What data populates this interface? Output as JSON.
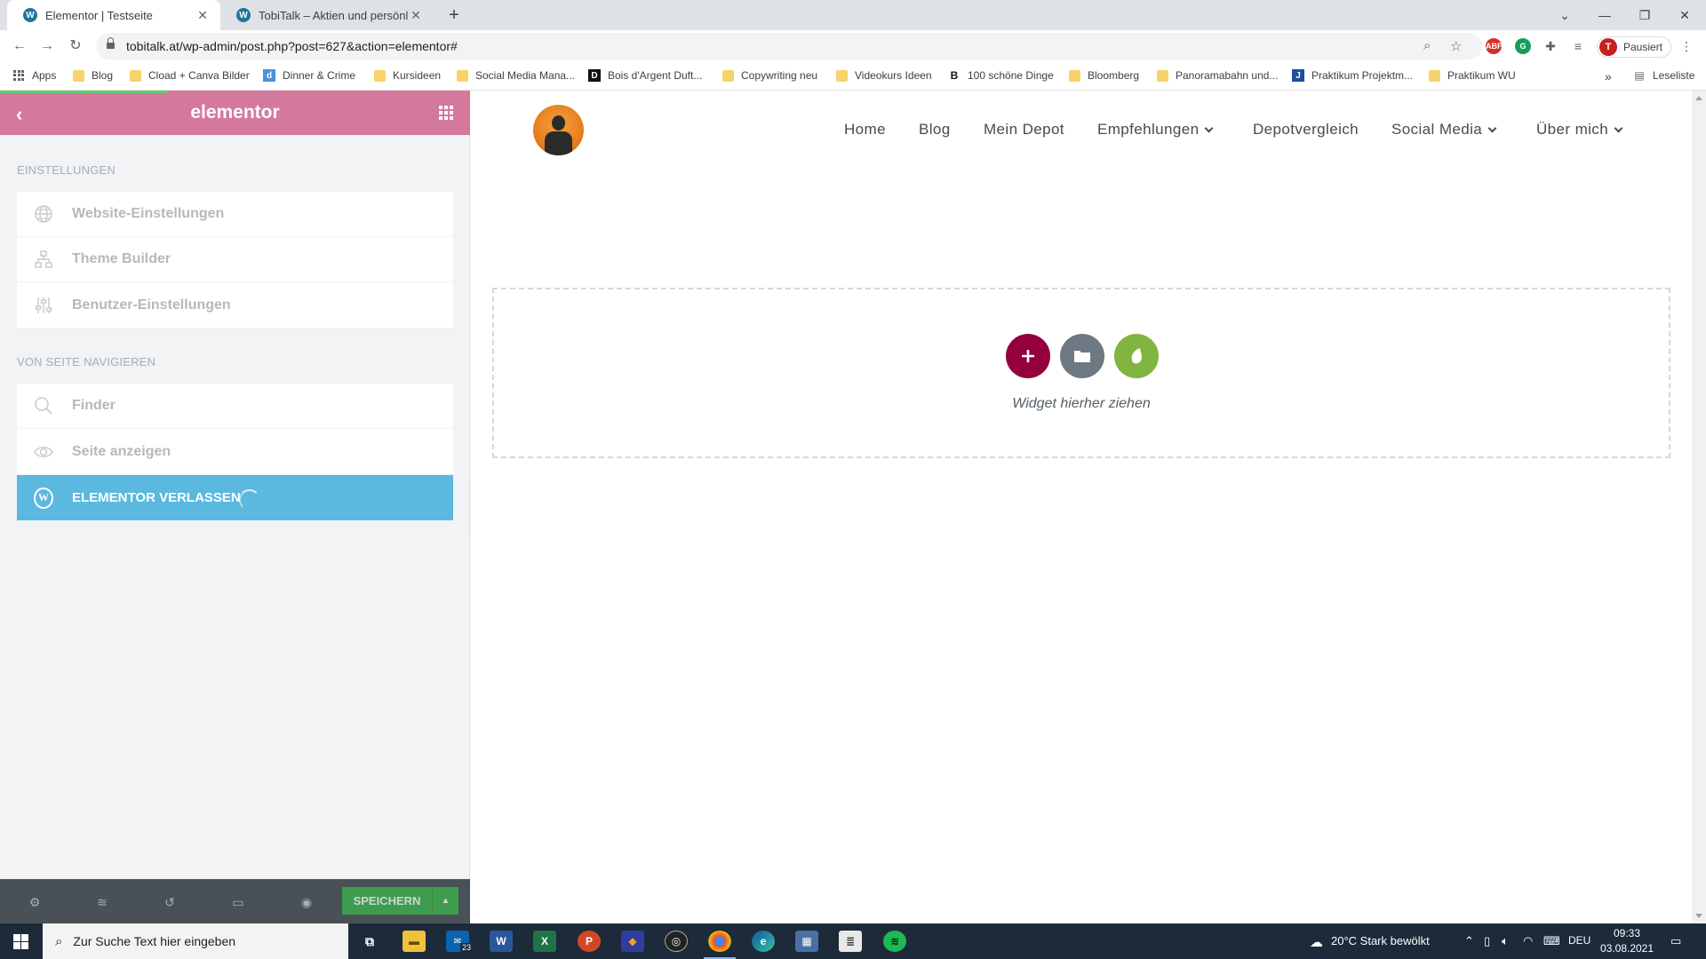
{
  "browser": {
    "tabs": [
      {
        "title": "Elementor | Testseite",
        "active": true
      },
      {
        "title": "TobiTalk – Aktien und persönliche",
        "active": false
      }
    ],
    "url": "tobitalk.at/wp-admin/post.php?post=627&action=elementor#",
    "profile_label": "Pausiert",
    "profile_initial": "T",
    "bookmarks": [
      {
        "label": "Apps",
        "icon": "apps-grid-icon"
      },
      {
        "label": "Blog",
        "icon": "folder-icon"
      },
      {
        "label": "Cload + Canva Bilder",
        "icon": "folder-icon"
      },
      {
        "label": "Dinner & Crime",
        "icon": "site-icon"
      },
      {
        "label": "Kursideen",
        "icon": "folder-icon"
      },
      {
        "label": "Social Media Mana...",
        "icon": "folder-icon"
      },
      {
        "label": "Bois d'Argent Duft...",
        "icon": "site-icon"
      },
      {
        "label": "Copywriting neu",
        "icon": "folder-icon"
      },
      {
        "label": "Videokurs Ideen",
        "icon": "folder-icon"
      },
      {
        "label": "100 schöne Dinge",
        "icon": "site-icon"
      },
      {
        "label": "Bloomberg",
        "icon": "folder-icon"
      },
      {
        "label": "Panoramabahn und...",
        "icon": "folder-icon"
      },
      {
        "label": "Praktikum Projektm...",
        "icon": "site-icon"
      },
      {
        "label": "Praktikum WU",
        "icon": "folder-icon"
      }
    ],
    "reading_list": "Leseliste",
    "overflow": "»"
  },
  "panel": {
    "logo": "elementor",
    "section_settings": "EINSTELLUNGEN",
    "settings_items": [
      {
        "label": "Website-Einstellungen",
        "icon": "globe-icon"
      },
      {
        "label": "Theme Builder",
        "icon": "sitemap-icon"
      },
      {
        "label": "Benutzer-Einstellungen",
        "icon": "sliders-icon"
      }
    ],
    "section_navigate": "VON SEITE NAVIGIEREN",
    "navigate_items": [
      {
        "label": "Finder",
        "icon": "search-icon"
      },
      {
        "label": "Seite anzeigen",
        "icon": "eye-icon"
      }
    ],
    "exit_label": "ELEMENTOR VERLASSEN",
    "save_label": "SPEICHERN"
  },
  "site": {
    "nav": [
      {
        "label": "Home",
        "dropdown": false
      },
      {
        "label": "Blog",
        "dropdown": false
      },
      {
        "label": "Mein Depot",
        "dropdown": false
      },
      {
        "label": "Empfehlungen",
        "dropdown": true
      },
      {
        "label": "Depotvergleich",
        "dropdown": false
      },
      {
        "label": "Social Media",
        "dropdown": true
      },
      {
        "label": "Über mich",
        "dropdown": true
      }
    ],
    "dropzone_text": "Widget hierher ziehen"
  },
  "taskbar": {
    "search_placeholder": "Zur Suche Text hier eingeben",
    "mail_badge": "23",
    "weather": "20°C  Stark bewölkt",
    "language": "DEU",
    "time": "09:33",
    "date": "03.08.2021"
  },
  "colors": {
    "panel_header": "#d5799c",
    "exit_button": "#5bb8de",
    "save_button": "#39b54a",
    "add_section": "#93003c",
    "template": "#6d7882",
    "envato": "#81b441"
  }
}
